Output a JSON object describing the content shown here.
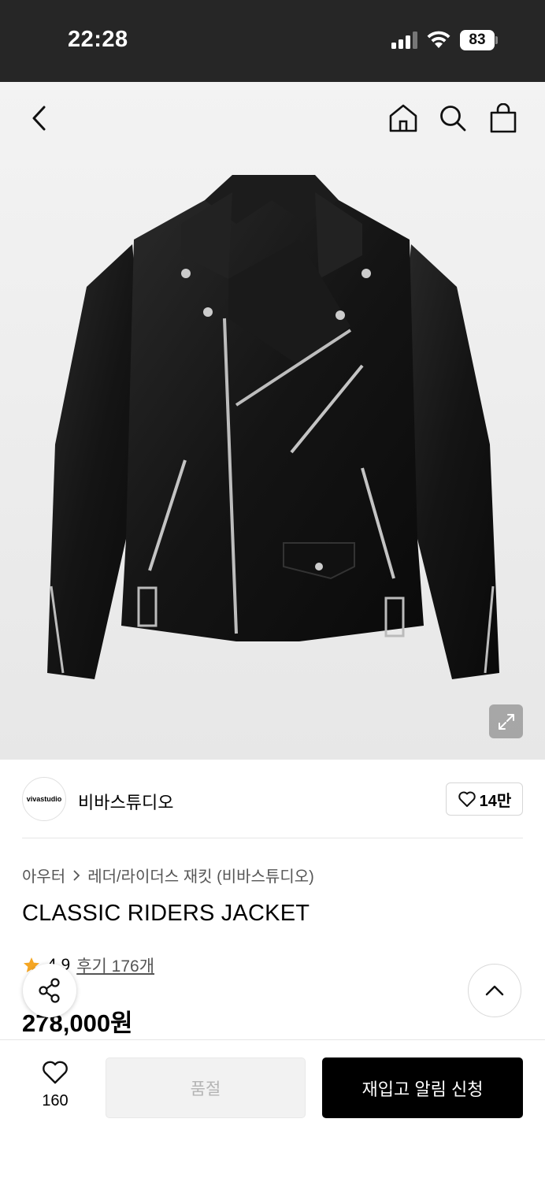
{
  "status_bar": {
    "time": "22:28",
    "battery": "83"
  },
  "header": {
    "back_icon": "chevron-left-icon",
    "home_icon": "home-icon",
    "search_icon": "search-icon",
    "cart_icon": "shopping-bag-icon"
  },
  "brand": {
    "logo_text": "vivastudio",
    "name": "비바스튜디오",
    "likes": "14만"
  },
  "breadcrumb": {
    "category": "아우터",
    "subcategory": "레더/라이더스 재킷 (비바스튜디오)"
  },
  "product": {
    "title": "CLASSIC RIDERS JACKET",
    "rating": "4.9",
    "reviews": "후기 176개",
    "price": "278,000원"
  },
  "bottom_bar": {
    "wish_count": "160",
    "soldout_label": "품절",
    "restock_label": "재입고 알림 신청"
  },
  "colors": {
    "status_bar_bg": "#262626",
    "primary_button": "#000000",
    "disabled_button": "#f2f2f2",
    "star": "#f5a623"
  }
}
